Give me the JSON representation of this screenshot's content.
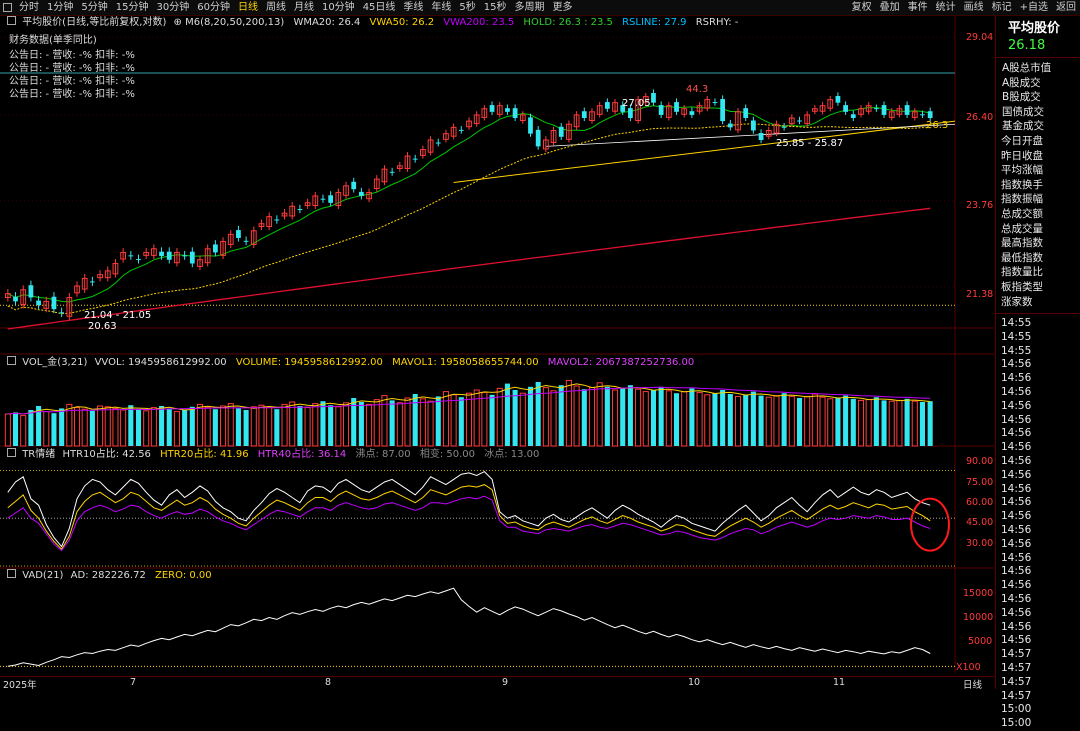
{
  "toolbar": {
    "periods": [
      "分时",
      "1分钟",
      "5分钟",
      "15分钟",
      "30分钟",
      "60分钟",
      "日线",
      "周线",
      "月线",
      "10分钟",
      "45日线",
      "季线",
      "年线",
      "5秒",
      "15秒",
      "多周期",
      "更多"
    ],
    "active": "日线",
    "right_buttons": [
      "复权",
      "叠加",
      "事件",
      "统计",
      "画线",
      "标记",
      "+自选",
      "返回"
    ]
  },
  "main_header": {
    "title": "平均股价(日线,等比前复权,对数)",
    "indicator": "M6(8,20,50,200,13)",
    "wma20": "WMA20: 26.4",
    "vwa50": "VWA50: 26.2",
    "vwa200": "VWA200: 23.5",
    "hold": "HOLD: 26.3 : 23.5",
    "rsline": "RSLINE: 27.9",
    "rsrhy": "RSRHY: -"
  },
  "financial": {
    "title": "财务数据(单季同比)",
    "rows": [
      "公告日: -   营收: -%   扣非: -%",
      "公告日: -   营收: -%   扣非: -%",
      "公告日: -   营收: -%   扣非: -%",
      "公告日: -   营收: -%   扣非: -%"
    ]
  },
  "price_axis": [
    "29.04",
    "26.40",
    "23.76",
    "21.38"
  ],
  "annotations": {
    "high_mark": "27.05",
    "peak_label": "44.3",
    "range_right": "25.85 - 25.87",
    "range_left": "21.04 - 21.05",
    "low_mark": "20.63",
    "last_price_tag": "26.3"
  },
  "vol_header": {
    "name": "VOL_金(3,21)",
    "vvol": "VVOL: 1945958612992.00",
    "volume": "VOLUME: 1945958612992.00",
    "mavol1": "MAVOL1: 1958058655744.00",
    "mavol2": "MAVOL2: 2067387252736.00"
  },
  "tr_header": {
    "name": "TR情绪",
    "htr10": "HTR10占比: 42.56",
    "htr20": "HTR20占比: 41.96",
    "htr40": "HTR40占比: 36.14",
    "boil": "沸点: 87.00",
    "neutral": "相变: 50.00",
    "freeze": "冰点: 13.00"
  },
  "tr_axis": [
    "90.00",
    "75.00",
    "60.00",
    "45.00",
    "30.00"
  ],
  "vad_header": {
    "name": "VAD(21)",
    "ad": "AD: 282226.72",
    "zero": "ZERO: 0.00"
  },
  "vad_axis": [
    "15000",
    "10000",
    "5000"
  ],
  "vad_unit": "X100",
  "date_axis": [
    "2025年",
    "7",
    "8",
    "9",
    "10",
    "11"
  ],
  "date_axis_right": "日线",
  "right_panel": {
    "title": "平均股价",
    "price": "26.18",
    "items": [
      "A股总市值",
      "A股成交",
      "B股成交",
      "国债成交",
      "基金成交",
      "今日开盘",
      "昨日收盘",
      "平均涨幅",
      "指数换手",
      "指数振幅",
      "总成交额",
      "总成交量",
      "最高指数",
      "最低指数",
      "指数量比",
      "板指类型",
      "涨家数"
    ],
    "times": [
      "14:55",
      "14:55",
      "14:55",
      "14:56",
      "14:56",
      "14:56",
      "14:56",
      "14:56",
      "14:56",
      "14:56",
      "14:56",
      "14:56",
      "14:56",
      "14:56",
      "14:56",
      "14:56",
      "14:56",
      "14:56",
      "14:56",
      "14:56",
      "14:56",
      "14:56",
      "14:56",
      "14:56",
      "14:57",
      "14:57",
      "14:57",
      "14:57",
      "15:00",
      "15:00"
    ]
  },
  "colors": {
    "up": "#ff3b3b",
    "down": "#33e6f0",
    "wma20": "#00c800",
    "vwa50": "#ffd400",
    "vwa200": "#e01030",
    "white": "#ffffff",
    "magenta": "#c000ff",
    "yellow": "#ffd400"
  },
  "chart_data": [
    {
      "type": "candlestick",
      "title": "平均股价(日线,等比前复权,对数)",
      "x_range": [
        "2025-06",
        "2025-11"
      ],
      "ylim": [
        20.5,
        29.3
      ],
      "y_scale": "log",
      "grid": false,
      "close": [
        21.2,
        21.0,
        21.3,
        21.1,
        20.9,
        21.0,
        20.8,
        20.7,
        21.1,
        21.4,
        21.6,
        21.5,
        21.7,
        21.8,
        22.0,
        22.3,
        22.2,
        22.1,
        22.3,
        22.4,
        22.2,
        22.1,
        22.3,
        22.2,
        22.0,
        22.1,
        22.4,
        22.3,
        22.6,
        22.8,
        22.7,
        22.6,
        22.9,
        23.1,
        23.3,
        23.2,
        23.4,
        23.6,
        23.5,
        23.7,
        23.9,
        23.8,
        23.7,
        24.0,
        24.2,
        24.1,
        23.9,
        24.0,
        24.4,
        24.7,
        24.6,
        24.8,
        25.1,
        25.0,
        25.3,
        25.6,
        25.5,
        25.8,
        26.0,
        25.9,
        26.2,
        26.4,
        26.6,
        26.5,
        26.7,
        26.5,
        26.3,
        26.4,
        25.8,
        25.4,
        25.6,
        25.9,
        25.7,
        26.1,
        26.4,
        26.3,
        26.5,
        26.7,
        26.6,
        26.8,
        26.5,
        26.3,
        26.9,
        27.0,
        26.8,
        26.4,
        26.7,
        26.5,
        26.6,
        26.4,
        26.7,
        26.9,
        26.8,
        26.2,
        26.0,
        26.5,
        26.3,
        25.9,
        25.6,
        25.9,
        26.1,
        26.0,
        26.3,
        26.2,
        26.4,
        26.6,
        26.7,
        26.9,
        26.8,
        26.5,
        26.3,
        26.6,
        26.7,
        26.6,
        26.4,
        26.5,
        26.6,
        26.4,
        26.5,
        26.4,
        26.3
      ]
    },
    {
      "type": "bar",
      "title": "VOL_金(3,21)",
      "ylim": [
        0,
        100
      ],
      "values": [
        40,
        42,
        38,
        45,
        50,
        43,
        41,
        47,
        52,
        48,
        46,
        44,
        50,
        49,
        47,
        45,
        51,
        46,
        44,
        48,
        50,
        47,
        43,
        45,
        49,
        52,
        48,
        46,
        50,
        53,
        47,
        45,
        49,
        51,
        48,
        46,
        52,
        55,
        50,
        48,
        53,
        56,
        51,
        49,
        54,
        60,
        55,
        52,
        58,
        63,
        57,
        54,
        60,
        65,
        59,
        56,
        62,
        68,
        64,
        61,
        66,
        70,
        67,
        64,
        72,
        78,
        70,
        66,
        74,
        80,
        73,
        69,
        76,
        82,
        75,
        71,
        73,
        79,
        74,
        70,
        72,
        76,
        71,
        68,
        70,
        74,
        69,
        66,
        68,
        72,
        67,
        64,
        66,
        70,
        65,
        62,
        64,
        68,
        63,
        61,
        63,
        66,
        62,
        60,
        62,
        65,
        61,
        59,
        60,
        63,
        59,
        57,
        58,
        61,
        57,
        56,
        57,
        59,
        56,
        55,
        56
      ],
      "series_lines": [
        {
          "name": "MAVOL1"
        },
        {
          "name": "MAVOL2"
        }
      ]
    },
    {
      "type": "line",
      "title": "TR情绪",
      "ylim": [
        13,
        95
      ],
      "series": [
        {
          "name": "HTR10占比",
          "values": [
            70,
            78,
            82,
            65,
            60,
            45,
            35,
            28,
            42,
            65,
            75,
            80,
            78,
            72,
            68,
            74,
            80,
            77,
            70,
            64,
            60,
            68,
            72,
            66,
            70,
            75,
            71,
            63,
            58,
            55,
            50,
            48,
            56,
            62,
            69,
            73,
            70,
            66,
            62,
            71,
            75,
            74,
            70,
            77,
            80,
            76,
            72,
            70,
            74,
            78,
            80,
            76,
            72,
            68,
            74,
            82,
            79,
            76,
            80,
            84,
            85,
            83,
            86,
            80,
            55,
            50,
            52,
            48,
            46,
            44,
            50,
            53,
            49,
            47,
            51,
            55,
            58,
            54,
            50,
            56,
            60,
            57,
            53,
            50,
            47,
            43,
            48,
            52,
            50,
            46,
            44,
            42,
            40,
            46,
            51,
            56,
            60,
            54,
            48,
            52,
            58,
            62,
            66,
            60,
            55,
            62,
            68,
            72,
            66,
            70,
            74,
            70,
            68,
            72,
            70,
            66,
            68,
            70,
            65,
            62,
            60
          ]
        },
        {
          "name": "HTR20占比",
          "values": [
            58,
            63,
            68,
            56,
            50,
            40,
            32,
            26,
            36,
            55,
            63,
            68,
            70,
            66,
            62,
            65,
            70,
            68,
            63,
            58,
            56,
            60,
            64,
            60,
            62,
            66,
            63,
            57,
            53,
            50,
            46,
            44,
            50,
            55,
            60,
            64,
            62,
            59,
            56,
            62,
            66,
            66,
            63,
            68,
            71,
            68,
            65,
            64,
            66,
            69,
            71,
            68,
            65,
            62,
            66,
            72,
            70,
            68,
            71,
            74,
            75,
            74,
            76,
            72,
            52,
            46,
            47,
            44,
            42,
            41,
            45,
            47,
            45,
            43,
            46,
            49,
            51,
            48,
            46,
            49,
            52,
            50,
            47,
            45,
            43,
            40,
            42,
            45,
            44,
            41,
            39,
            37,
            36,
            40,
            44,
            47,
            50,
            47,
            43,
            46,
            50,
            53,
            56,
            52,
            49,
            53,
            57,
            60,
            57,
            59,
            62,
            60,
            58,
            61,
            60,
            57,
            58,
            59,
            55,
            52,
            48
          ]
        },
        {
          "name": "HTR40占比",
          "values": [
            50,
            54,
            58,
            50,
            46,
            38,
            30,
            25,
            33,
            48,
            55,
            58,
            60,
            58,
            55,
            57,
            60,
            59,
            55,
            52,
            50,
            53,
            55,
            53,
            54,
            57,
            55,
            51,
            48,
            46,
            43,
            41,
            45,
            49,
            53,
            56,
            55,
            53,
            51,
            55,
            58,
            58,
            56,
            60,
            62,
            60,
            58,
            57,
            58,
            61,
            62,
            60,
            58,
            56,
            58,
            62,
            62,
            61,
            63,
            65,
            66,
            65,
            67,
            64,
            48,
            43,
            43,
            40,
            39,
            38,
            41,
            42,
            41,
            40,
            42,
            44,
            45,
            43,
            42,
            44,
            46,
            45,
            43,
            41,
            39,
            37,
            38,
            40,
            39,
            37,
            35,
            34,
            33,
            35,
            38,
            40,
            42,
            41,
            38,
            40,
            43,
            45,
            47,
            45,
            43,
            45,
            48,
            50,
            49,
            50,
            52,
            51,
            50,
            52,
            51,
            49,
            49,
            50,
            47,
            44,
            42
          ]
        }
      ],
      "reference_lines": [
        87,
        50,
        13
      ]
    },
    {
      "type": "line",
      "title": "VAD(21)",
      "ylim": [
        -1500,
        19000
      ],
      "series": [
        {
          "name": "AD",
          "values": [
            0,
            300,
            800,
            500,
            200,
            900,
            1500,
            2200,
            2000,
            2600,
            3100,
            2900,
            3400,
            3800,
            3600,
            4200,
            4800,
            4500,
            5200,
            5800,
            6300,
            6000,
            6600,
            7200,
            6900,
            7500,
            8100,
            7800,
            8600,
            9400,
            9100,
            9800,
            10600,
            10300,
            11000,
            10600,
            11400,
            12100,
            11700,
            12300,
            12800,
            12400,
            13100,
            13600,
            13200,
            13900,
            14400,
            14000,
            14600,
            15200,
            14800,
            15400,
            16000,
            15700,
            16300,
            16800,
            16400,
            17000,
            17600,
            15000,
            13500,
            12200,
            13200,
            12400,
            11600,
            12600,
            13400,
            12900,
            12100,
            11400,
            12200,
            13000,
            12500,
            11800,
            11200,
            10400,
            11000,
            10200,
            9400,
            8700,
            9300,
            8600,
            7900,
            7300,
            7900,
            7200,
            6600,
            7200,
            6700,
            6000,
            5500,
            6000,
            5400,
            4900,
            5400,
            4800,
            4300,
            4900,
            4400,
            4000,
            4500,
            4000,
            3600,
            4200,
            3800,
            3400,
            3900,
            3500,
            3100,
            3600,
            3300,
            2900,
            3400,
            3100,
            2800,
            3300,
            3000,
            3600,
            4200,
            3800,
            2900
          ]
        }
      ],
      "zero_line": 0
    }
  ]
}
